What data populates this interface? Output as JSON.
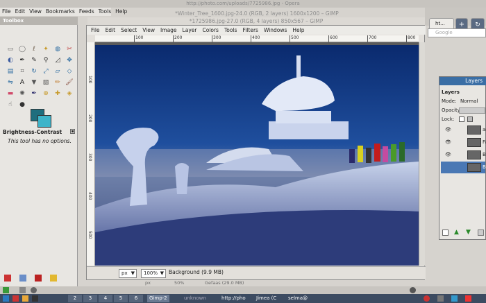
{
  "opera": {
    "title": "http://photo.com/uploads/7725986.jpg - Opera",
    "menu": [
      "File",
      "Edit",
      "View",
      "Bookmarks",
      "Feeds",
      "Tools",
      "Help"
    ],
    "tab_label": "ht...",
    "search_placeholder": "Google"
  },
  "toolbox": {
    "title": "Toolbox",
    "options_header": "Brightness-Contrast",
    "options_msg": "This tool has no options.",
    "fg_color": "#1f6e7e",
    "bg_color": "#3fb4c9"
  },
  "image_window": {
    "title_back": "*Winter_Tree_1600.jpg-24.0 (RGB, 2 layers) 1600x1200 – GIMP",
    "title": "*1725986.jpg-27.0 (RGB, 4 layers) 850x567 – GIMP",
    "menu": [
      "File",
      "Edit",
      "Select",
      "View",
      "Image",
      "Layer",
      "Colors",
      "Tools",
      "Filters",
      "Windows",
      "Help"
    ],
    "ruler_top": [
      "100",
      "200",
      "300",
      "400",
      "500",
      "600",
      "700",
      "800"
    ],
    "ruler_left": [
      "100",
      "200",
      "300",
      "400",
      "500"
    ],
    "unit": "px",
    "zoom": "100%",
    "status": "Background (9.9 MB)",
    "back_unit": "px",
    "back_zoom": "50%",
    "back_status": "Gefaas (29.0 MB)"
  },
  "layers": {
    "title": "Layers",
    "section": "Layers",
    "mode_label": "Mode:",
    "mode_value": "Normal",
    "opacity_label": "Opacity:",
    "lock_label": "Lock:",
    "items": [
      {
        "name": "as",
        "selected": false
      },
      {
        "name": "Fa",
        "selected": false
      },
      {
        "name": "Ba",
        "selected": false
      },
      {
        "name": "Ba",
        "selected": true
      }
    ]
  },
  "taskbar": {
    "workspaces": [
      "2",
      "3",
      "4",
      "5",
      "6"
    ],
    "items": [
      "Gimp-2",
      "unknown",
      "http://pho",
      "Jimea (C",
      "selma@"
    ]
  }
}
